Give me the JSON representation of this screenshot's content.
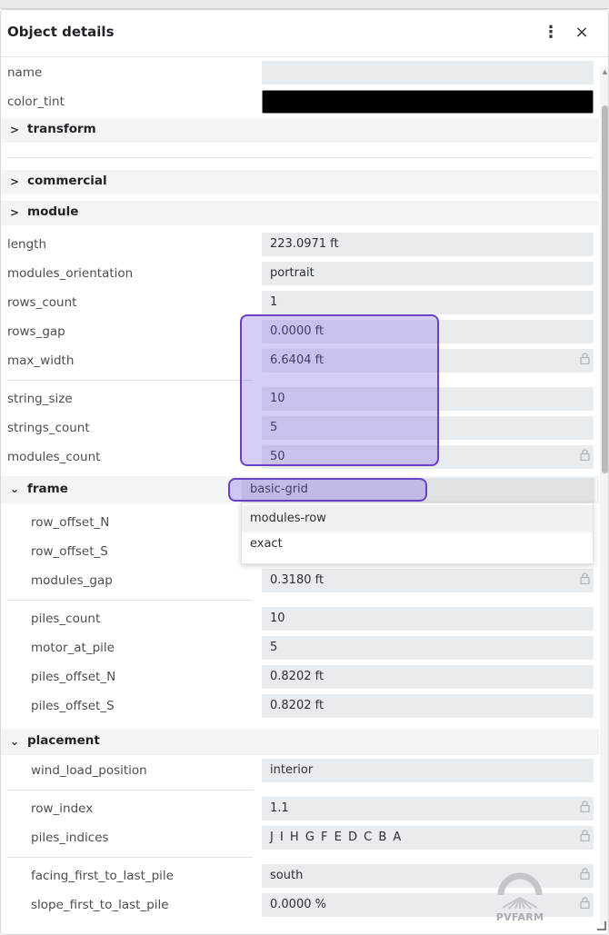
{
  "panel": {
    "title": "Object details",
    "menu_icon": "⋮",
    "close_icon": "×"
  },
  "top_fields": [
    {
      "label": "name",
      "value": ""
    },
    {
      "label": "color_tint",
      "value": "",
      "swatch": "#000000"
    }
  ],
  "sections": {
    "transform": "transform",
    "commercial": "commercial",
    "module": "module",
    "frame": "frame",
    "placement": "placement"
  },
  "module_fields": [
    {
      "label": "length",
      "value": "223.0971 ft"
    },
    {
      "label": "modules_orientation",
      "value": "portrait"
    },
    {
      "label": "rows_count",
      "value": "1"
    },
    {
      "label": "rows_gap",
      "value": "0.0000 ft"
    },
    {
      "label": "max_width",
      "value": "6.6404 ft",
      "locked": true
    },
    {
      "label": "string_size",
      "value": "10"
    },
    {
      "label": "strings_count",
      "value": "5"
    },
    {
      "label": "modules_count",
      "value": "50",
      "locked": true
    }
  ],
  "frame": {
    "selected": "basic-grid",
    "options": [
      "modules-row",
      "exact"
    ]
  },
  "frame_fields": [
    {
      "label": "row_offset_N",
      "value": ""
    },
    {
      "label": "row_offset_S",
      "value": ""
    },
    {
      "label": "modules_gap",
      "value": "0.3180 ft",
      "locked": true
    },
    {
      "label": "piles_count",
      "value": "10"
    },
    {
      "label": "motor_at_pile",
      "value": "5"
    },
    {
      "label": "piles_offset_N",
      "value": "0.8202 ft"
    },
    {
      "label": "piles_offset_S",
      "value": "0.8202 ft"
    }
  ],
  "placement_fields": [
    {
      "label": "wind_load_position",
      "value": "interior"
    },
    {
      "label": "row_index",
      "value": "1.1",
      "locked": true
    },
    {
      "label": "piles_indices",
      "value": "J I H G F E D C B A",
      "locked": true
    },
    {
      "label": "facing_first_to_last_pile",
      "value": "south",
      "locked": true
    },
    {
      "label": "slope_first_to_last_pile",
      "value": "0.0000 %",
      "locked": true
    }
  ],
  "logo_text": "PVFARM",
  "colors": {
    "highlight_border": "#6b3fc6",
    "highlight_fill": "#7b5ce6",
    "field_bg": "#e9ecee",
    "section_bg": "#f3f4f5"
  }
}
